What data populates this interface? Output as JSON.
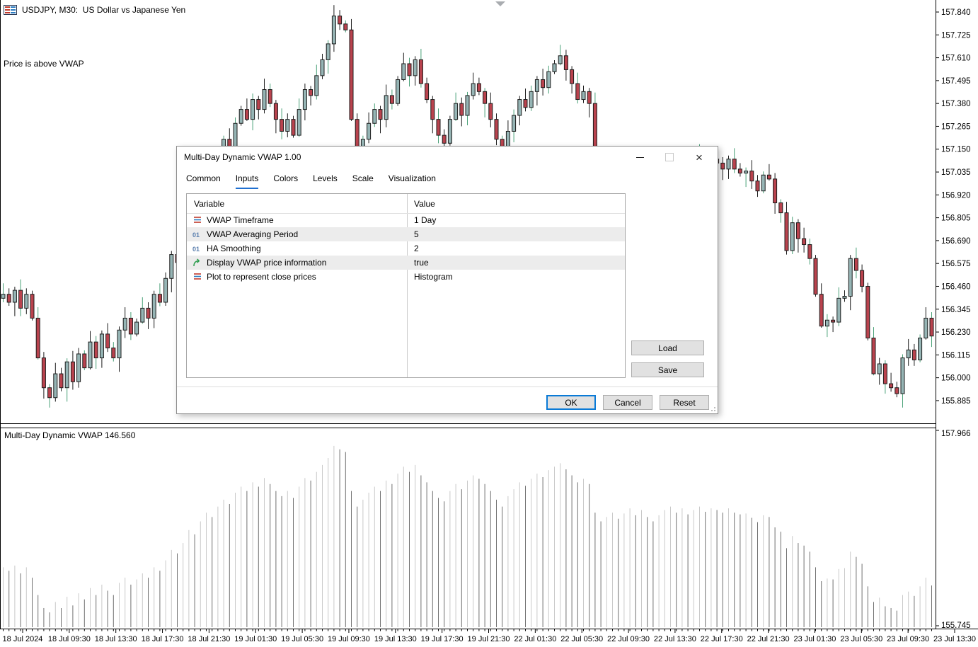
{
  "window": {
    "symbol_title": "USDJPY, M30:  US Dollar vs Japanese Yen",
    "overlay_note": "Price is above VWAP"
  },
  "indicator_panel": {
    "label": "Multi-Day Dynamic VWAP 146.560",
    "axis_top": "157.966",
    "axis_bottom": "155.745"
  },
  "main_axis_labels": [
    "157.840",
    "157.725",
    "157.610",
    "157.495",
    "157.380",
    "157.265",
    "157.150",
    "157.035",
    "156.920",
    "156.805",
    "156.690",
    "156.575",
    "156.460",
    "156.345",
    "156.230",
    "156.115",
    "156.000",
    "155.885"
  ],
  "time_axis_labels": [
    "18 Jul 2024",
    "18 Jul 09:30",
    "18 Jul 13:30",
    "18 Jul 17:30",
    "18 Jul 21:30",
    "19 Jul 01:30",
    "19 Jul 05:30",
    "19 Jul 09:30",
    "19 Jul 13:30",
    "19 Jul 17:30",
    "19 Jul 21:30",
    "22 Jul 01:30",
    "22 Jul 05:30",
    "22 Jul 09:30",
    "22 Jul 13:30",
    "22 Jul 17:30",
    "22 Jul 21:30",
    "23 Jul 01:30",
    "23 Jul 05:30",
    "23 Jul 09:30",
    "23 Jul 13:30"
  ],
  "dialog": {
    "title": "Multi-Day Dynamic VWAP 1.00",
    "tabs": [
      "Common",
      "Inputs",
      "Colors",
      "Levels",
      "Scale",
      "Visualization"
    ],
    "active_tab": "Inputs",
    "table": {
      "headers": [
        "Variable",
        "Value"
      ],
      "rows": [
        {
          "icon": "enum",
          "label": "VWAP Timeframe",
          "value": "1 Day"
        },
        {
          "icon": "number",
          "label": "VWAP Averaging Period",
          "value": "5"
        },
        {
          "icon": "number",
          "label": "HA Smoothing",
          "value": "2"
        },
        {
          "icon": "bool",
          "label": "Display VWAP price information",
          "value": "true"
        },
        {
          "icon": "enum",
          "label": "Plot to represent close prices",
          "value": "Histogram"
        }
      ]
    },
    "buttons": {
      "load": "Load",
      "save": "Save",
      "ok": "OK",
      "cancel": "Cancel",
      "reset": "Reset"
    }
  },
  "chart_data": {
    "type": "candlestick",
    "symbol": "USDJPY",
    "timeframe": "M30",
    "main_axis_range": [
      155.885,
      157.84
    ],
    "indicator_axis_range": [
      155.745,
      157.966
    ],
    "lower_panel": "histogram of close prices",
    "closes": [
      156.42,
      156.38,
      156.44,
      156.35,
      156.42,
      156.3,
      156.1,
      155.95,
      155.9,
      156.02,
      155.95,
      156.08,
      155.98,
      156.12,
      156.05,
      156.18,
      156.1,
      156.22,
      156.15,
      156.1,
      156.24,
      156.3,
      156.22,
      156.28,
      156.35,
      156.3,
      156.42,
      156.38,
      156.5,
      156.62,
      156.58,
      156.7,
      156.85,
      156.8,
      156.95,
      157.05,
      157.0,
      157.12,
      157.2,
      157.15,
      157.28,
      157.35,
      157.3,
      157.4,
      157.35,
      157.45,
      157.38,
      157.3,
      157.24,
      157.3,
      157.22,
      157.35,
      157.45,
      157.42,
      157.52,
      157.6,
      157.68,
      157.82,
      157.78,
      157.75,
      157.3,
      157.12,
      157.2,
      157.28,
      157.35,
      157.3,
      157.42,
      157.38,
      157.5,
      157.58,
      157.52,
      157.6,
      157.48,
      157.4,
      157.3,
      157.22,
      157.18,
      157.3,
      157.38,
      157.32,
      157.42,
      157.48,
      157.44,
      157.38,
      157.3,
      157.2,
      157.12,
      157.24,
      157.32,
      157.4,
      157.36,
      157.44,
      157.5,
      157.46,
      157.54,
      157.58,
      157.62,
      157.55,
      157.48,
      157.4,
      157.44,
      157.38,
      157.05,
      156.95,
      157.0,
      157.05,
      156.98,
      157.04,
      157.1,
      157.02,
      157.08,
      157.0,
      156.95,
      157.02,
      157.08,
      157.12,
      157.05,
      157.1,
      157.03,
      157.08,
      157.12,
      157.06,
      157.1,
      157.08,
      157.05,
      157.1,
      157.05,
      157.03,
      157.04,
      156.99,
      156.94,
      157.02,
      157.0,
      156.88,
      156.83,
      156.64,
      156.78,
      156.7,
      156.67,
      156.6,
      156.42,
      156.26,
      156.29,
      156.28,
      156.4,
      156.41,
      156.6,
      156.54,
      156.46,
      156.2,
      156.02,
      156.07,
      155.97,
      155.95,
      155.92,
      156.1,
      156.14,
      156.09,
      156.2,
      156.3,
      156.21
    ]
  },
  "colors": {
    "bull_body": "#96B5B5",
    "bear_body": "#B9434E",
    "wick_black": "#1c1c1c",
    "wick_green": "#4aa178",
    "hist_light": "#c9c9c9",
    "hist_dark": "#707070",
    "accent_blue": "#0a7ad6",
    "row_alt": "#ececec"
  }
}
